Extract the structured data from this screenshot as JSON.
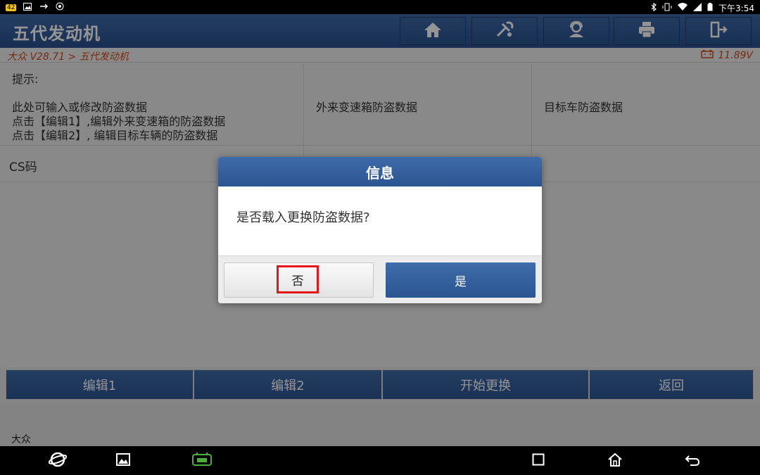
{
  "statusbar": {
    "time": "下午3:54",
    "battery_badge": "42"
  },
  "header": {
    "title": "五代发动机",
    "toolbar": [
      {
        "icon": "home-icon"
      },
      {
        "icon": "diagnostic-tool-icon"
      },
      {
        "icon": "user-support-icon"
      },
      {
        "icon": "printer-icon"
      },
      {
        "icon": "exit-icon"
      }
    ]
  },
  "breadcrumb": {
    "path": "大众 V28.71 > 五代发动机",
    "voltage": "11.89V",
    "accent_color": "#d24a1c"
  },
  "content": {
    "hint_title": "提示:",
    "hint_lines": [
      "此处可输入或修改防盗数据",
      "点击【编辑1】,编辑外来变速箱的防盗数据",
      "点击【编辑2】, 编辑目标车辆的防盗数据"
    ],
    "col_external": "外来变速箱防盗数据",
    "col_target": "目标车防盗数据",
    "row_cs": "CS码"
  },
  "actions": {
    "edit1": "编辑1",
    "edit2": "编辑2",
    "start_replace": "开始更换",
    "back": "返回"
  },
  "footer": {
    "brand": "大众"
  },
  "dialog": {
    "title": "信息",
    "message": "是否载入更换防盗数据?",
    "no_label": "否",
    "yes_label": "是",
    "highlight_color": "#e6151a"
  }
}
